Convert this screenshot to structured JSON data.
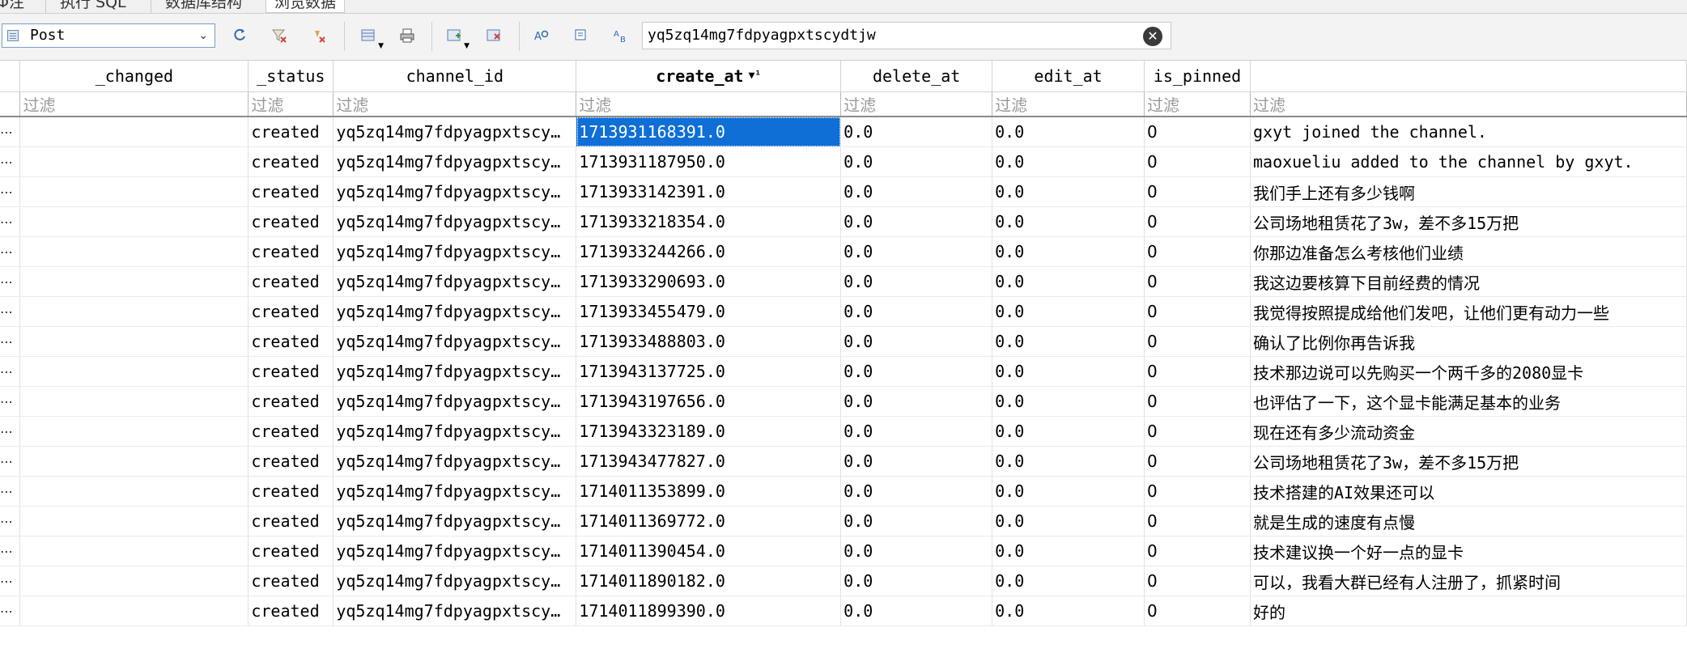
{
  "tabs": [
    {
      "label": "Φ注"
    },
    {
      "label": "执行 SQL"
    },
    {
      "label": "数据库结构"
    },
    {
      "label": "浏览数据"
    }
  ],
  "toolbar": {
    "table_name": "Post",
    "filter_value": "yq5zq14mg7fdpyagpxtscydtjw",
    "icons": [
      "refresh-icon",
      "clear-filters-icon",
      "clear-sort-icon",
      "save-filter-icon",
      "print-icon",
      "insert-record-icon",
      "delete-record-icon",
      "find-icon",
      "find-replace-icon",
      "copy-icon"
    ]
  },
  "grid": {
    "columns": [
      "_changed",
      "_status",
      "channel_id",
      "create_at",
      "delete_at",
      "edit_at",
      "is_pinned",
      ""
    ],
    "sorted_column_index": 3,
    "filter_placeholder": "过滤",
    "row_header": "⋯",
    "rows": [
      {
        "changed": "",
        "status": "created",
        "channel": "yq5zq14mg7fdpyagpxtscy…",
        "create_at": "1713931168391.0",
        "delete_at": "0.0",
        "edit_at": "0.0",
        "is_pinned": "0",
        "message": "gxyt joined the channel."
      },
      {
        "changed": "",
        "status": "created",
        "channel": "yq5zq14mg7fdpyagpxtscy…",
        "create_at": "1713931187950.0",
        "delete_at": "0.0",
        "edit_at": "0.0",
        "is_pinned": "0",
        "message": "maoxueliu added to the channel by gxyt."
      },
      {
        "changed": "",
        "status": "created",
        "channel": "yq5zq14mg7fdpyagpxtscy…",
        "create_at": "1713933142391.0",
        "delete_at": "0.0",
        "edit_at": "0.0",
        "is_pinned": "0",
        "message": "我们手上还有多少钱啊"
      },
      {
        "changed": "",
        "status": "created",
        "channel": "yq5zq14mg7fdpyagpxtscy…",
        "create_at": "1713933218354.0",
        "delete_at": "0.0",
        "edit_at": "0.0",
        "is_pinned": "0",
        "message": "公司场地租赁花了3w，差不多15万把"
      },
      {
        "changed": "",
        "status": "created",
        "channel": "yq5zq14mg7fdpyagpxtscy…",
        "create_at": "1713933244266.0",
        "delete_at": "0.0",
        "edit_at": "0.0",
        "is_pinned": "0",
        "message": "你那边准备怎么考核他们业绩"
      },
      {
        "changed": "",
        "status": "created",
        "channel": "yq5zq14mg7fdpyagpxtscy…",
        "create_at": "1713933290693.0",
        "delete_at": "0.0",
        "edit_at": "0.0",
        "is_pinned": "0",
        "message": "我这边要核算下目前经费的情况"
      },
      {
        "changed": "",
        "status": "created",
        "channel": "yq5zq14mg7fdpyagpxtscy…",
        "create_at": "1713933455479.0",
        "delete_at": "0.0",
        "edit_at": "0.0",
        "is_pinned": "0",
        "message": "我觉得按照提成给他们发吧，让他们更有动力一些"
      },
      {
        "changed": "",
        "status": "created",
        "channel": "yq5zq14mg7fdpyagpxtscy…",
        "create_at": "1713933488803.0",
        "delete_at": "0.0",
        "edit_at": "0.0",
        "is_pinned": "0",
        "message": "确认了比例你再告诉我"
      },
      {
        "changed": "",
        "status": "created",
        "channel": "yq5zq14mg7fdpyagpxtscy…",
        "create_at": "1713943137725.0",
        "delete_at": "0.0",
        "edit_at": "0.0",
        "is_pinned": "0",
        "message": "技术那边说可以先购买一个两千多的2080显卡"
      },
      {
        "changed": "",
        "status": "created",
        "channel": "yq5zq14mg7fdpyagpxtscy…",
        "create_at": "1713943197656.0",
        "delete_at": "0.0",
        "edit_at": "0.0",
        "is_pinned": "0",
        "message": "也评估了一下，这个显卡能满足基本的业务"
      },
      {
        "changed": "",
        "status": "created",
        "channel": "yq5zq14mg7fdpyagpxtscy…",
        "create_at": "1713943323189.0",
        "delete_at": "0.0",
        "edit_at": "0.0",
        "is_pinned": "0",
        "message": "现在还有多少流动资金"
      },
      {
        "changed": "",
        "status": "created",
        "channel": "yq5zq14mg7fdpyagpxtscy…",
        "create_at": "1713943477827.0",
        "delete_at": "0.0",
        "edit_at": "0.0",
        "is_pinned": "0",
        "message": "公司场地租赁花了3w，差不多15万把"
      },
      {
        "changed": "",
        "status": "created",
        "channel": "yq5zq14mg7fdpyagpxtscy…",
        "create_at": "1714011353899.0",
        "delete_at": "0.0",
        "edit_at": "0.0",
        "is_pinned": "0",
        "message": "技术搭建的AI效果还可以"
      },
      {
        "changed": "",
        "status": "created",
        "channel": "yq5zq14mg7fdpyagpxtscy…",
        "create_at": "1714011369772.0",
        "delete_at": "0.0",
        "edit_at": "0.0",
        "is_pinned": "0",
        "message": "就是生成的速度有点慢"
      },
      {
        "changed": "",
        "status": "created",
        "channel": "yq5zq14mg7fdpyagpxtscy…",
        "create_at": "1714011390454.0",
        "delete_at": "0.0",
        "edit_at": "0.0",
        "is_pinned": "0",
        "message": "技术建议换一个好一点的显卡"
      },
      {
        "changed": "",
        "status": "created",
        "channel": "yq5zq14mg7fdpyagpxtscy…",
        "create_at": "1714011890182.0",
        "delete_at": "0.0",
        "edit_at": "0.0",
        "is_pinned": "0",
        "message": "可以，我看大群已经有人注册了，抓紧时间"
      },
      {
        "changed": "",
        "status": "created",
        "channel": "yq5zq14mg7fdpyagpxtscy…",
        "create_at": "1714011899390.0",
        "delete_at": "0.0",
        "edit_at": "0.0",
        "is_pinned": "0",
        "message": "好的"
      }
    ],
    "selected_row": 0,
    "selected_column": "create_at"
  },
  "colors": {
    "selection": "#0f6fd6",
    "toolbar_bg": "#f3f3f3",
    "icon_blue": "#2e6bb0",
    "icon_red": "#d0453a"
  }
}
